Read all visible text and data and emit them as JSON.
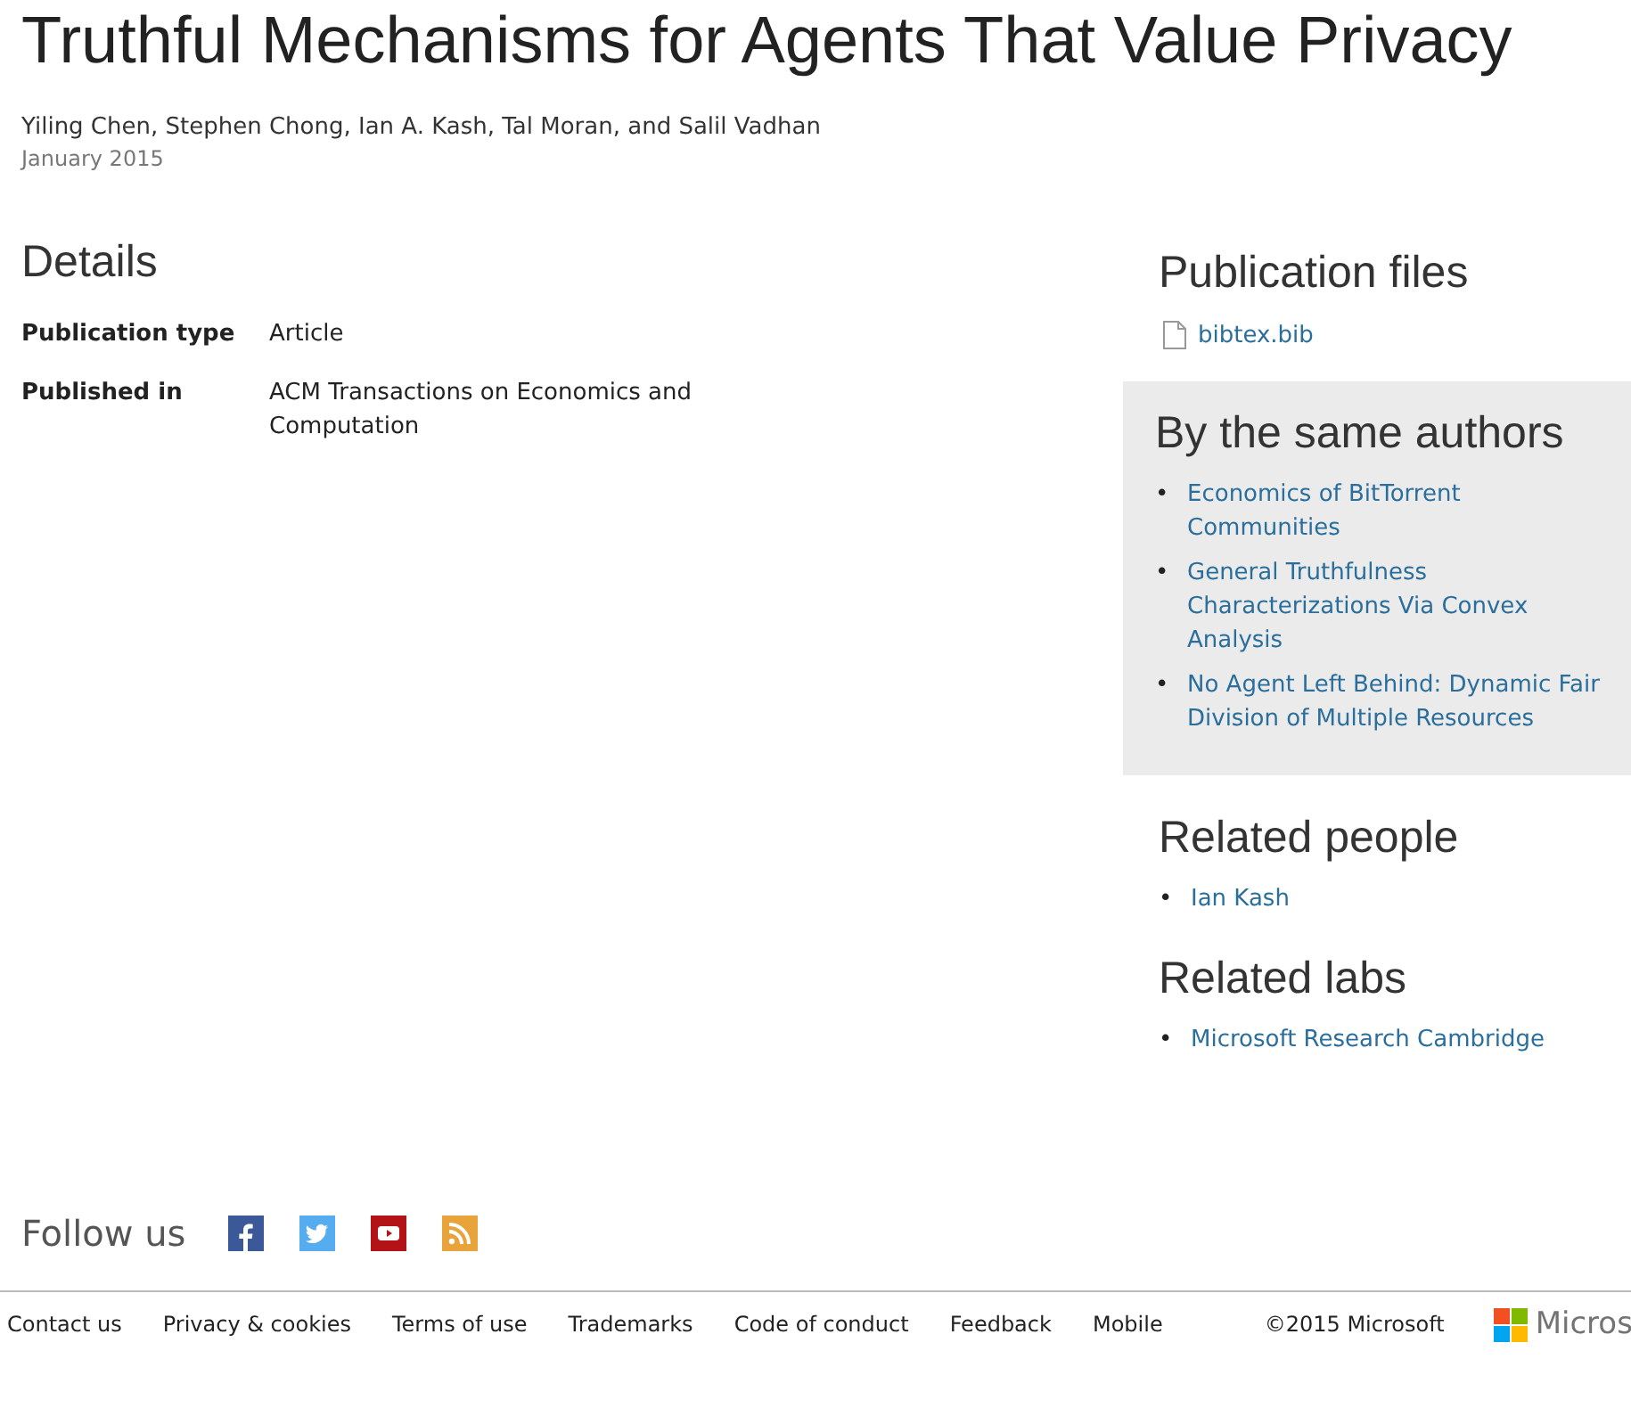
{
  "title": "Truthful Mechanisms for Agents That Value Privacy",
  "authors": "Yiling Chen, Stephen Chong, Ian A. Kash, Tal Moran, and Salil Vadhan",
  "date": "January 2015",
  "details": {
    "heading": "Details",
    "rows": [
      {
        "label": "Publication type",
        "value": "Article"
      },
      {
        "label": "Published in",
        "value": "ACM Transactions on Economics and Computation"
      }
    ]
  },
  "sidebar": {
    "files": {
      "heading": "Publication files",
      "items": [
        "bibtex.bib"
      ]
    },
    "bullet": "•",
    "same_authors": {
      "heading": "By the same authors",
      "items": [
        "Economics of BitTorrent Communities",
        "General Truthfulness Characterizations Via Convex Analysis",
        "No Agent Left Behind: Dynamic Fair Division of Multiple Resources"
      ]
    },
    "related_people": {
      "heading": "Related people",
      "items": [
        "Ian Kash"
      ]
    },
    "related_labs": {
      "heading": "Related labs",
      "items": [
        "Microsoft Research Cambridge"
      ]
    }
  },
  "follow": {
    "label": "Follow us",
    "icons": [
      {
        "kind": "facebook"
      },
      {
        "kind": "twitter"
      },
      {
        "kind": "youtube"
      },
      {
        "kind": "rss"
      }
    ]
  },
  "footer": {
    "links": [
      "Contact us",
      "Privacy & cookies",
      "Terms of use",
      "Trademarks",
      "Code of conduct",
      "Feedback",
      "Mobile"
    ],
    "copyright": "©2015 Microsoft",
    "logo_text": "Micros"
  }
}
